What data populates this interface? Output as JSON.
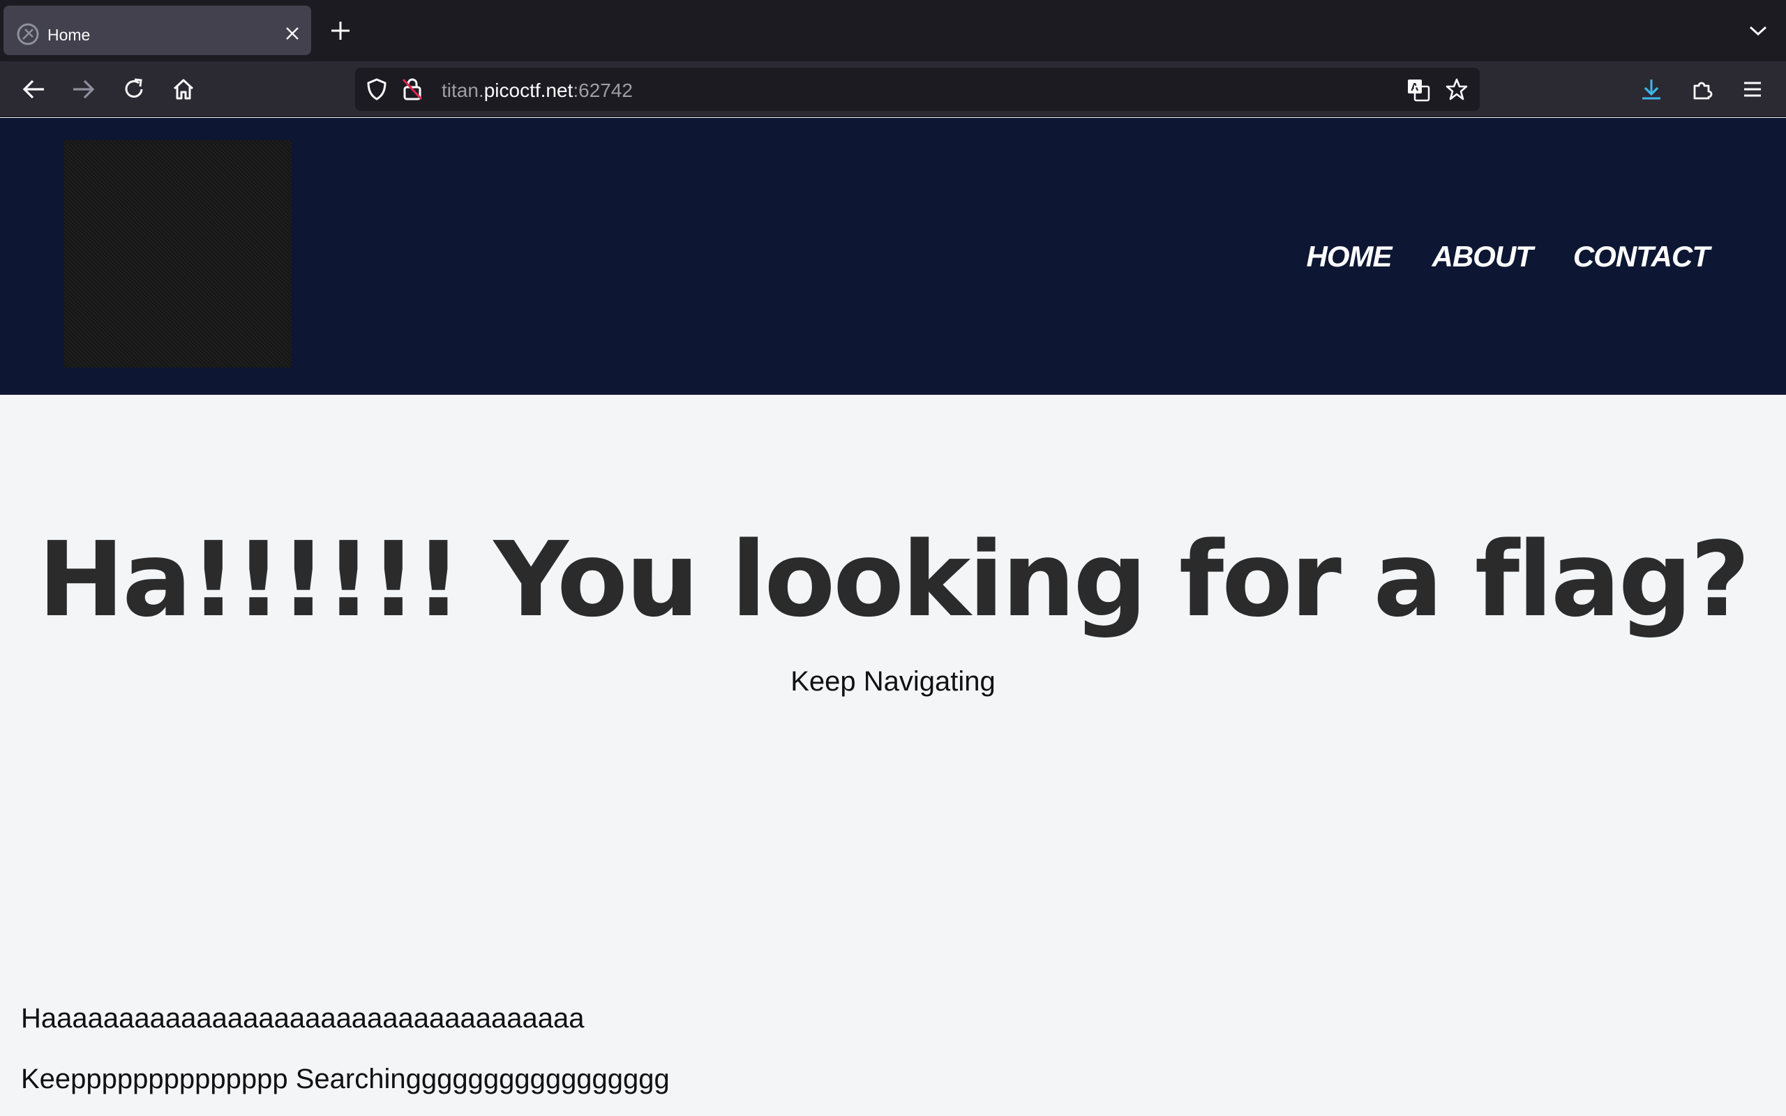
{
  "browser": {
    "tab_title": "Home",
    "url_prefix": "titan.",
    "url_host": "picoctf.net",
    "url_port": ":62742"
  },
  "site": {
    "nav": [
      "HOME",
      "ABOUT",
      "CONTACT"
    ]
  },
  "hero": {
    "title": "Ha!!!!!! You looking for a flag?",
    "subtitle": "Keep Navigating"
  },
  "body_text": [
    "Haaaaaaaaaaaaaaaaaaaaaaaaaaaaaaaaaaa",
    "Keepppppppppppppp Searchinggggggggggggggggg"
  ],
  "colors": {
    "header_bg": "#0d1733",
    "page_bg": "#f4f5f7",
    "chrome_bg": "#2b2a33"
  }
}
